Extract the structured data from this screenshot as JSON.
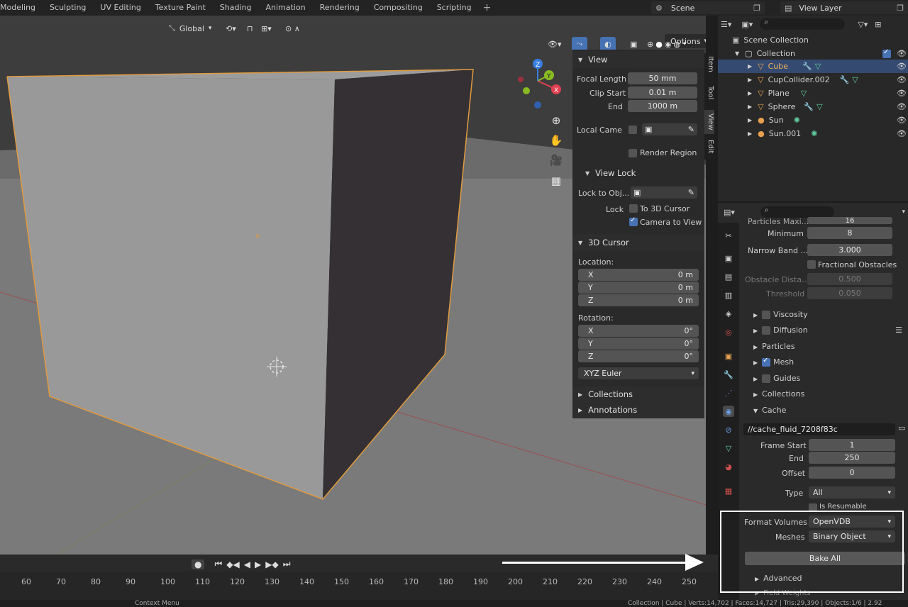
{
  "workspace_tabs": [
    "Modeling",
    "Sculpting",
    "UV Editing",
    "Texture Paint",
    "Shading",
    "Animation",
    "Rendering",
    "Compositing",
    "Scripting"
  ],
  "add_tab": "+",
  "scene": "Scene",
  "view_layer": "View Layer",
  "viewport": {
    "orientation": "Global",
    "options": "Options",
    "gizmo_x": "X",
    "gizmo_y": "Y",
    "gizmo_z": "Z"
  },
  "npanel": {
    "tabs": [
      "Item",
      "Tool",
      "View",
      "Edit"
    ],
    "view_header": "View",
    "focal_length_label": "Focal Length",
    "focal_length": "50 mm",
    "clip_start_label": "Clip Start",
    "clip_start": "0.01 m",
    "end_label": "End",
    "clip_end": "1000 m",
    "local_camera_label": "Local Came",
    "render_region": "Render Region",
    "view_lock_header": "View Lock",
    "lock_to_obj_label": "Lock to Obj...",
    "lock_label": "Lock",
    "to_3d_cursor": "To 3D Cursor",
    "camera_to_view": "Camera to View",
    "cursor_header": "3D Cursor",
    "location_label": "Location:",
    "rotation_label": "Rotation:",
    "loc": [
      {
        "axis": "X",
        "value": "0 m"
      },
      {
        "axis": "Y",
        "value": "0 m"
      },
      {
        "axis": "Z",
        "value": "0 m"
      }
    ],
    "rot": [
      {
        "axis": "X",
        "value": "0°"
      },
      {
        "axis": "Y",
        "value": "0°"
      },
      {
        "axis": "Z",
        "value": "0°"
      }
    ],
    "rotation_mode": "XYZ Euler",
    "collections": "Collections",
    "annotations": "Annotations"
  },
  "outliner": {
    "scene_collection": "Scene Collection",
    "collection": "Collection",
    "items": [
      {
        "name": "Cube",
        "selected": true
      },
      {
        "name": "CupCollider.002",
        "selected": false
      },
      {
        "name": "Plane",
        "selected": false
      },
      {
        "name": "Sphere",
        "selected": false
      },
      {
        "name": "Sun",
        "selected": false
      },
      {
        "name": "Sun.001",
        "selected": false
      }
    ]
  },
  "props": {
    "particles_max_label": "Particles Maxi...",
    "particles_max": "16",
    "minimum_label": "Minimum",
    "minimum": "8",
    "narrow_band_label": "Narrow Band ...",
    "narrow_band": "3.000",
    "fractional_obstacles": "Fractional Obstacles",
    "obstacle_dist_label": "Obstacle Dista...",
    "obstacle_dist": "0.500",
    "threshold_label": "Threshold",
    "threshold": "0.050",
    "viscosity": "Viscosity",
    "diffusion": "Diffusion",
    "particles": "Particles",
    "mesh": "Mesh",
    "guides": "Guides",
    "collections": "Collections",
    "cache": "Cache",
    "cache_path": "//cache_fluid_7208f83c",
    "frame_start_label": "Frame Start",
    "frame_start": "1",
    "end_label": "End",
    "end": "250",
    "offset_label": "Offset",
    "offset": "0",
    "type_label": "Type",
    "type": "All",
    "is_resumable": "Is Resumable",
    "format_volumes_label": "Format Volumes",
    "format_volumes": "OpenVDB",
    "meshes_label": "Meshes",
    "meshes": "Binary Object",
    "bake_all": "Bake All",
    "advanced": "Advanced",
    "next_section": "Field Weights"
  },
  "timeline_ticks": [
    "60",
    "70",
    "80",
    "90",
    "100",
    "110",
    "120",
    "130",
    "140",
    "150",
    "160",
    "170",
    "180",
    "190",
    "200",
    "210",
    "220",
    "230",
    "240",
    "250"
  ],
  "statusbar": {
    "left": "Context Menu",
    "right": "Collection | Cube | Verts:14,702 | Faces:14,727 | Tris:29,390 | Objects:1/6 | 2.92"
  }
}
